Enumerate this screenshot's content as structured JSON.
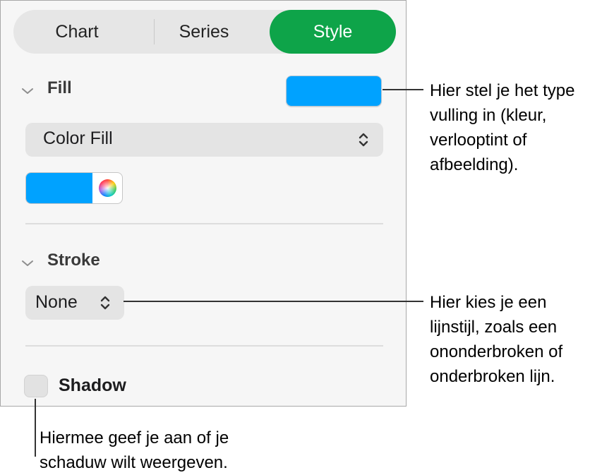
{
  "tabs": [
    {
      "label": "Chart",
      "active": false
    },
    {
      "label": "Series",
      "active": false
    },
    {
      "label": "Style",
      "active": true
    }
  ],
  "fill": {
    "title": "Fill",
    "type_value": "Color Fill",
    "swatch_color": "#00a2ff"
  },
  "stroke": {
    "title": "Stroke",
    "style_value": "None"
  },
  "shadow": {
    "label": "Shadow",
    "checked": false
  },
  "colors": {
    "accent_green": "#0ea449",
    "fill_blue": "#00a2ff"
  },
  "icons": [
    "chevron-down-icon",
    "up-down-arrows-icon",
    "color-wheel-icon"
  ],
  "callouts": {
    "fill": "Hier stel je het type\nvulling in (kleur,\nverlooptint of\nafbeelding).",
    "stroke": "Hier kies je een\nlijnstijl, zoals een\nononderbroken of\nonderbroken lijn.",
    "shadow": "Hiermee geef je aan of je\nschaduw wilt weergeven."
  }
}
